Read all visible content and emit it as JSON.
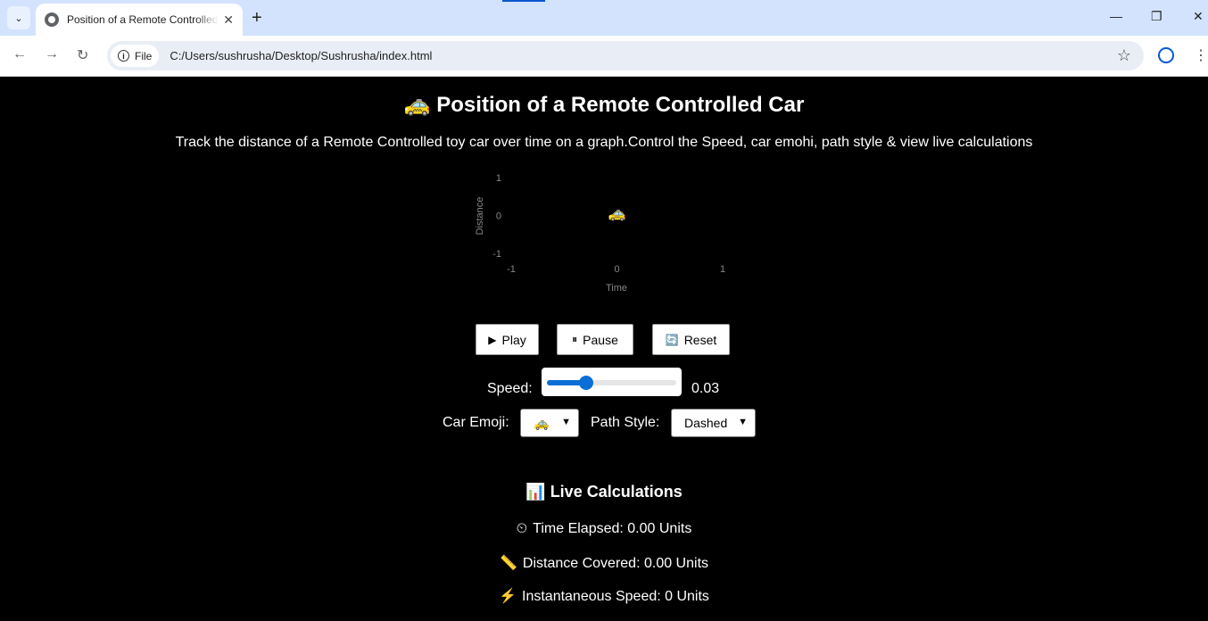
{
  "browser": {
    "tab_title": "Position of a Remote Controlled Car",
    "security_chip": "File",
    "url": "C:/Users/sushrusha/Desktop/Sushrusha/index.html"
  },
  "page": {
    "title_icon": "🚕",
    "title": "Position of a Remote Controlled Car",
    "subtitle": "Track the distance of a Remote Controlled toy car over time on a graph.Control the Speed, car emohi, path style & view live calculations"
  },
  "chart_data": {
    "type": "scatter",
    "xlabel": "Time",
    "ylabel": "Distance",
    "x_ticks": [
      "-1",
      "0",
      "1"
    ],
    "y_ticks": [
      "1",
      "0",
      "-1"
    ],
    "xlim": [
      -1,
      1
    ],
    "ylim": [
      -1,
      1
    ],
    "points": [
      {
        "x": 0,
        "y": 0,
        "marker": "🚕"
      }
    ]
  },
  "controls": {
    "play_icon": "▶",
    "play_label": "Play",
    "pause_icon": "⏸",
    "pause_label": "Pause",
    "reset_icon": "🔄",
    "reset_label": "Reset",
    "speed_label": "Speed:",
    "speed_value": "0.03",
    "speed_fraction": 0.3,
    "emoji_label": "Car Emoji:",
    "emoji_selected": "🚕",
    "path_label": "Path Style:",
    "path_selected": "Dashed"
  },
  "calculations": {
    "title_icon": "📊",
    "title": "Live Calculations",
    "time_icon": "⏲",
    "time_text": "Time Elapsed: 0.00 Units",
    "distance_icon": "📏",
    "distance_text": "Distance Covered: 0.00 Units",
    "speed_icon": "⚡",
    "speed_text": "Instantaneous Speed: 0 Units"
  }
}
